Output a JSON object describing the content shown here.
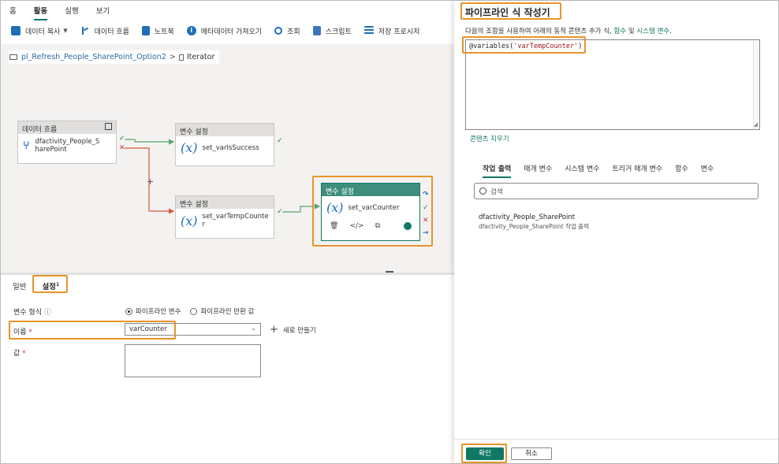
{
  "menu_tabs": [
    {
      "label": "홈",
      "active": false
    },
    {
      "label": "활동",
      "active": true
    },
    {
      "label": "실행",
      "active": false
    },
    {
      "label": "보기",
      "active": false
    }
  ],
  "toolbar": {
    "copy_data": "데이터 복사",
    "dataflow": "데이터 흐름",
    "notebook": "노트북",
    "get_metadata": "메타데이터 가져오기",
    "lookup": "조회",
    "script": "스크립트",
    "stored_procedure": "저장 프로시저"
  },
  "breadcrumb": {
    "pipeline": "pl_Refresh_People_SharePoint_Option2",
    "separator": ">",
    "activity": "Iterator"
  },
  "nodes": {
    "dataflow": {
      "header": "데이터 흐름",
      "name_line1": "dfactivity_People_S",
      "name_line2": "harePoint"
    },
    "set_success": {
      "header": "변수 설정",
      "name": "set_varIsSuccess"
    },
    "set_temp": {
      "header": "변수 설정",
      "name_line1": "set_varTempCounte",
      "name_line2": "r"
    },
    "set_counter": {
      "header": "변수 설정",
      "name": "set_varCounter"
    }
  },
  "canvas_plus": "+",
  "bottom_tabs": [
    {
      "label": "일반",
      "active": false
    },
    {
      "label": "설정",
      "badge": "1",
      "active": true
    }
  ],
  "form": {
    "var_type_label": "변수 형식",
    "var_type_info": "ⓘ",
    "radio_pipeline_var": "파이프라인 변수",
    "radio_return_value": "파이프라인 반환 값",
    "name_label": "이름",
    "name_value": "varCounter",
    "new_button": "새로 만들기",
    "value_label": "값",
    "required_mark": "*"
  },
  "expression_builder": {
    "title": "파이프라인 식 작성기",
    "description_prefix": "다음의 조합을 사용하여 아래의 동적 콘텐츠 추가 식,",
    "description_link1": "함수",
    "description_mid": "및",
    "description_link2": "시스템 변수",
    "expression_prefix": "@variables(",
    "expression_arg": "'varTempCounter'",
    "expression_suffix": ")",
    "clear_content": "콘텐츠 지우기",
    "tabs": [
      {
        "label": "작업 출력",
        "active": true
      },
      {
        "label": "매개 변수",
        "active": false
      },
      {
        "label": "시스템 변수",
        "active": false
      },
      {
        "label": "트리거 매개 변수",
        "active": false
      },
      {
        "label": "함수",
        "active": false
      },
      {
        "label": "변수",
        "active": false
      }
    ],
    "search_placeholder": "검색",
    "activity_output_title": "dfactivity_People_SharePoint",
    "activity_output_sub": "dfactivity_People_SharePoint 작업 출력",
    "ok_button": "확인",
    "cancel_button": "취소"
  },
  "colors": {
    "accent": "#117865",
    "highlight_box": "#e8932a",
    "success_arrow": "#107c41",
    "fail_arrow": "#d65a3a"
  }
}
